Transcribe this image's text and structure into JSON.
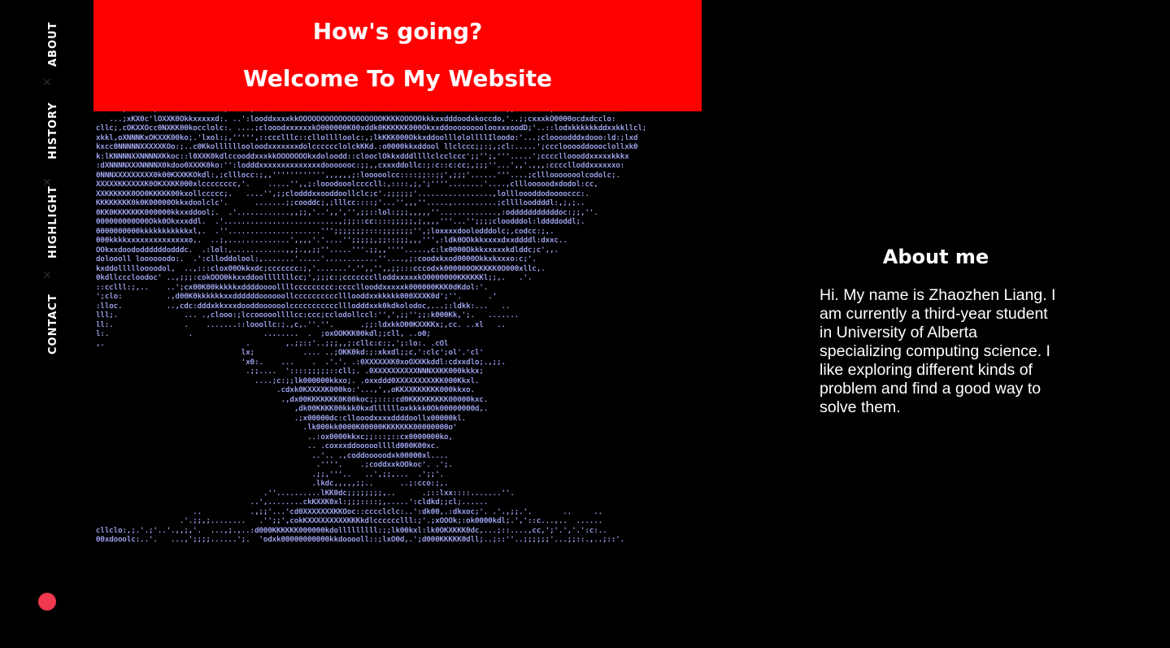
{
  "nav": {
    "items": [
      {
        "label": "ABOUT"
      },
      {
        "label": "HISTORY"
      },
      {
        "label": "HIGHLIGHT"
      },
      {
        "label": "CONTACT"
      }
    ],
    "separator": "✕",
    "dot_color": "#f0384f"
  },
  "hero": {
    "greeting": "How's going?",
    "welcome": "Welcome To My Website",
    "banner_color": "#ff0000"
  },
  "about": {
    "title": "About me",
    "text": "Hi. My name is Zhaozhen Liang. I am currently a third-year student in University of Alberta specializing computing science. I like exploring different kinds of problem and find a good way to solve them."
  }
}
